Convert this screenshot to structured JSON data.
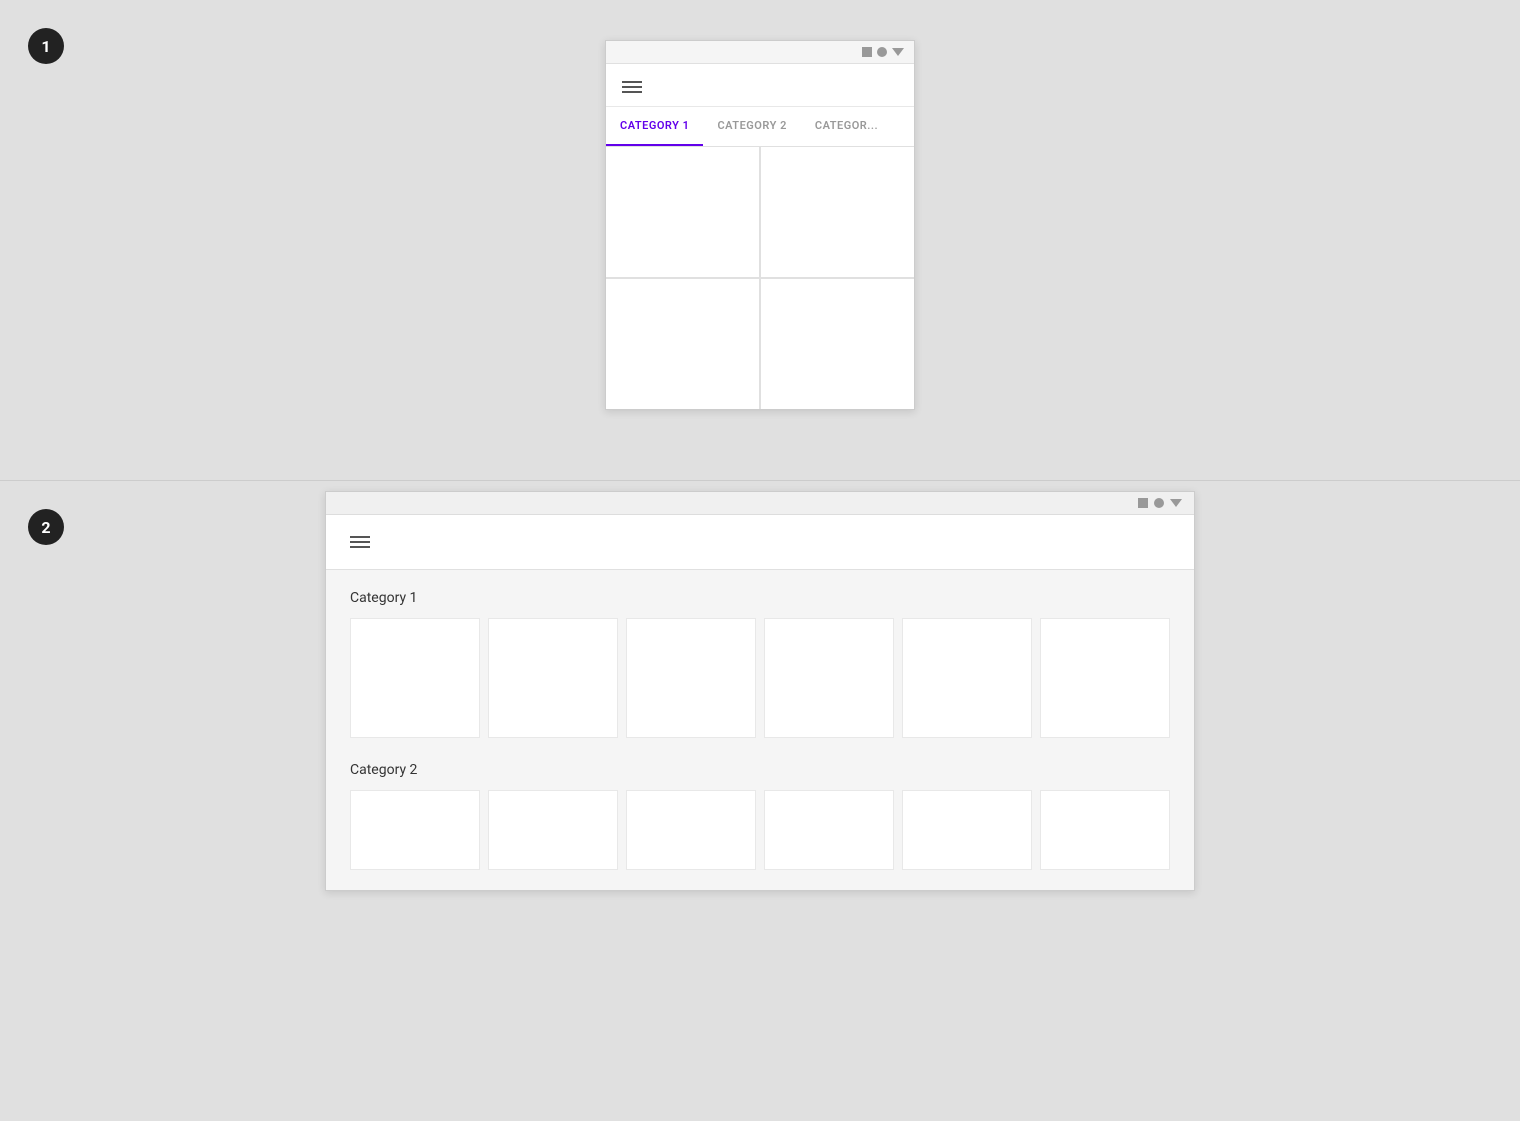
{
  "section1": {
    "badge": "1",
    "titlebar": {
      "icons": [
        "square",
        "circle",
        "arrow"
      ]
    },
    "tabs": [
      {
        "label": "CATEGORY 1",
        "active": true
      },
      {
        "label": "CATEGORY 2",
        "active": false
      },
      {
        "label": "CATEGOR...",
        "active": false
      }
    ],
    "grid_cells": 4
  },
  "section2": {
    "badge": "2",
    "titlebar": {
      "icons": [
        "square",
        "circle",
        "arrow"
      ]
    },
    "header": {
      "hamburger": true
    },
    "categories": [
      {
        "label": "Category 1",
        "cells": 6
      },
      {
        "label": "Category 2",
        "cells": 6
      }
    ]
  }
}
